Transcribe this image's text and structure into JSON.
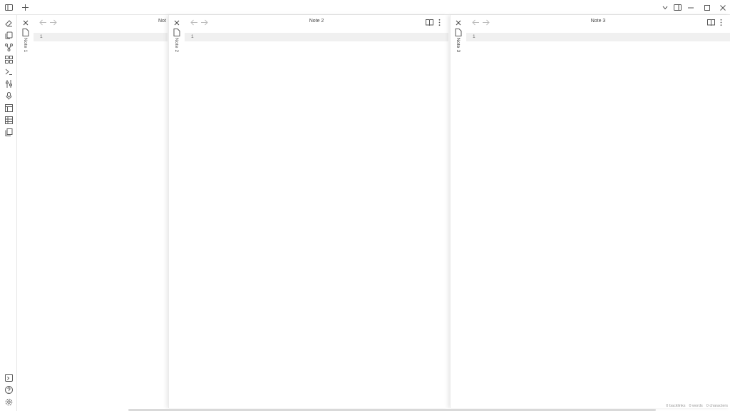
{
  "titlebar": {
    "new_tab_icon": "plus-icon",
    "sidebar_toggle_icon": "sidebar-left-icon",
    "tab_list_icon": "chevron-down-icon",
    "right_sidebar_icon": "sidebar-right-icon",
    "minimize_icon": "minimize-icon",
    "maximize_icon": "maximize-icon",
    "close_icon": "close-icon"
  },
  "ribbon": {
    "top_icons": [
      "eraser-icon",
      "copy-icon",
      "graph-icon",
      "dashboard-icon",
      "terminal-icon",
      "sliders-icon",
      "microphone-icon",
      "layout-icon",
      "table-icon",
      "files-icon"
    ],
    "bottom_icons": [
      "vault-icon",
      "help-icon",
      "settings-icon"
    ]
  },
  "panes": [
    {
      "title": "Note 1",
      "header_title": "Not",
      "line_number": "1"
    },
    {
      "title": "Note 2",
      "header_title": "Note 2",
      "line_number": "1"
    },
    {
      "title": "Note 3",
      "header_title": "Note 3",
      "line_number": "1"
    }
  ],
  "status_bar": {
    "backlinks": "0 backlinks",
    "words": "0 words",
    "characters": "0 characters"
  }
}
